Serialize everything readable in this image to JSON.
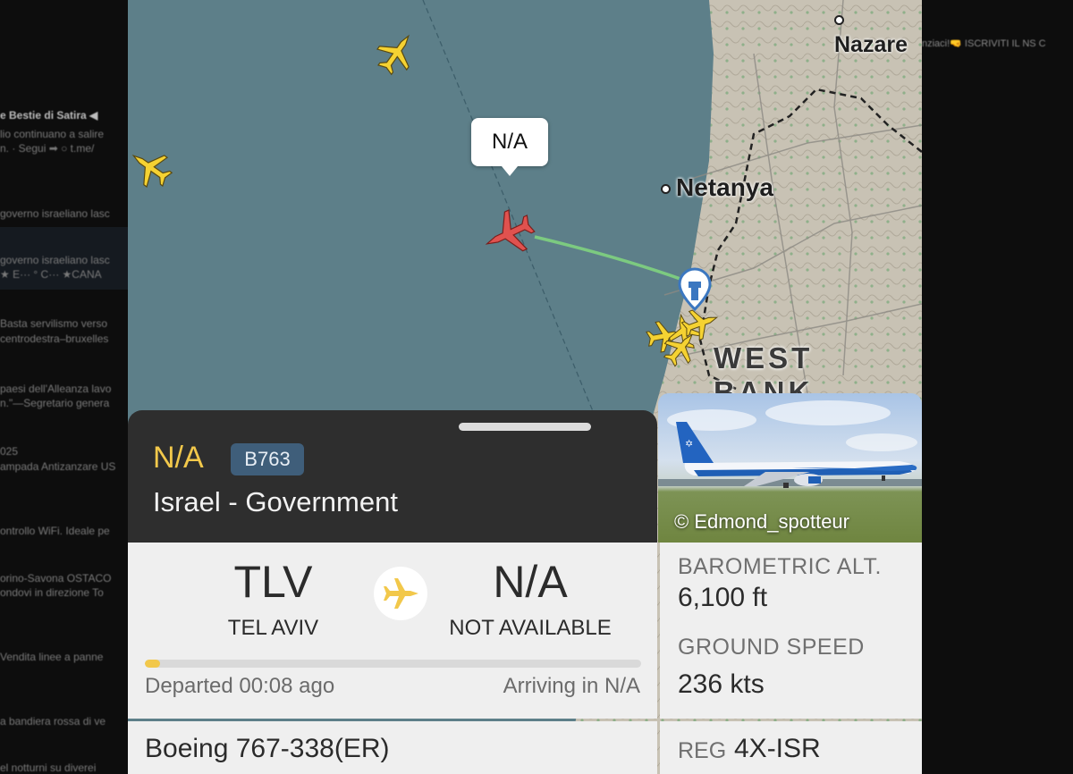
{
  "background_feed": {
    "left_lines": [
      {
        "text": "e Bestie di Satira ◀",
        "bold": true
      },
      {
        "text": "lio continuano a salire",
        "bold": false
      },
      {
        "text": "n. · Segui ➡ ○ t.me/",
        "bold": false
      },
      {
        "text": "governo israeliano lasc",
        "bold": false
      },
      {
        "text": "governo israeliano lasc",
        "bold": false
      },
      {
        "text": "★ E··· ° C··· ★CANA",
        "bold": false
      },
      {
        "text": "Basta servilismo verso",
        "bold": false
      },
      {
        "text": "centrodestra–bruxelles",
        "bold": false
      },
      {
        "text": "paesi dell'Alleanza lavo",
        "bold": false
      },
      {
        "text": "n.\"—Segretario genera",
        "bold": false
      },
      {
        "text": "025",
        "bold": false
      },
      {
        "text": "ampada Antizanzare US",
        "bold": false
      },
      {
        "text": "ontrollo WiFi. Ideale pe",
        "bold": false
      },
      {
        "text": "orino-Savona OSTACO",
        "bold": false
      },
      {
        "text": "ondovi in direzione To",
        "bold": false
      },
      {
        "text": "Vendita linee a panne",
        "bold": false
      },
      {
        "text": "a bandiera rossa di ve",
        "bold": false
      },
      {
        "text": "el notturni su diverei",
        "bold": false
      }
    ],
    "right_lines": [
      {
        "text": "nziaci!🤜  ISCRIVITI IL NS C"
      }
    ]
  },
  "map": {
    "cities": [
      {
        "name": "Nazare",
        "size": 25
      },
      {
        "name": "Netanya",
        "size": 28
      }
    ],
    "region_label": "WEST BANK",
    "selected_flight_callout": "N/A",
    "colors": {
      "sea": "#5d7f89",
      "land": "#c9c3b6",
      "selected_plane": "#e0524f",
      "other_planes": "#f5d232",
      "trail": "#7fd37f"
    }
  },
  "flight": {
    "callsign": "N/A",
    "aircraft_code": "B763",
    "operator": "Israel - Government",
    "photo_credit": "© Edmond_spotteur",
    "origin": {
      "code": "TLV",
      "name": "TEL AVIV"
    },
    "destination": {
      "code": "N/A",
      "name": "NOT AVAILABLE"
    },
    "progress_fraction": 0.03,
    "departed_text": "Departed 00:08 ago",
    "arriving_text": "Arriving in N/A",
    "stats": [
      {
        "label": "BAROMETRIC ALT.",
        "value": "6,100 ft"
      },
      {
        "label": "GROUND SPEED",
        "value": "236 kts"
      }
    ],
    "aircraft_model": "Boeing 767-338(ER)",
    "reg_label": "REG",
    "reg_value": "4X-ISR"
  }
}
